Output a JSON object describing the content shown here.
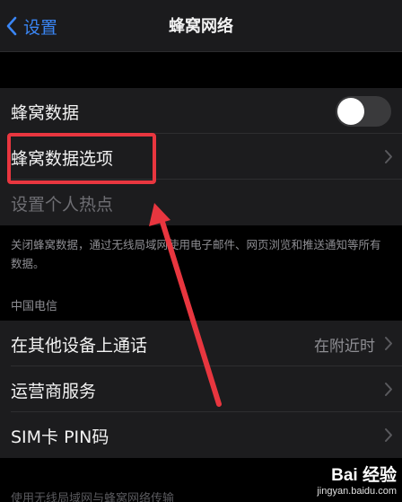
{
  "nav": {
    "back_label": "设置",
    "title": "蜂窝网络"
  },
  "cells": {
    "cellular_data": {
      "label": "蜂窝数据",
      "toggle_on": false
    },
    "cellular_options": {
      "label": "蜂窝数据选项"
    },
    "hotspot": {
      "label": "设置个人热点"
    }
  },
  "footer_note": "关闭蜂窝数据，通过无线局域网使用电子邮件、网页浏览和推送通知等所有数据。",
  "section": {
    "header": "中国电信",
    "items": [
      {
        "label": "在其他设备上通话",
        "detail": "在附近时"
      },
      {
        "label": "运营商服务",
        "detail": ""
      },
      {
        "label": "SIM卡 PIN码",
        "detail": ""
      }
    ]
  },
  "bottom_text": "使用无线局域网与蜂窝网络传输",
  "watermark": {
    "main": "Bai 经验",
    "sub": "jingyan.baidu.com"
  },
  "colors": {
    "accent": "#3a86f5",
    "highlight": "#e8363f",
    "background": "#000000",
    "cell": "#1c1c1e"
  }
}
